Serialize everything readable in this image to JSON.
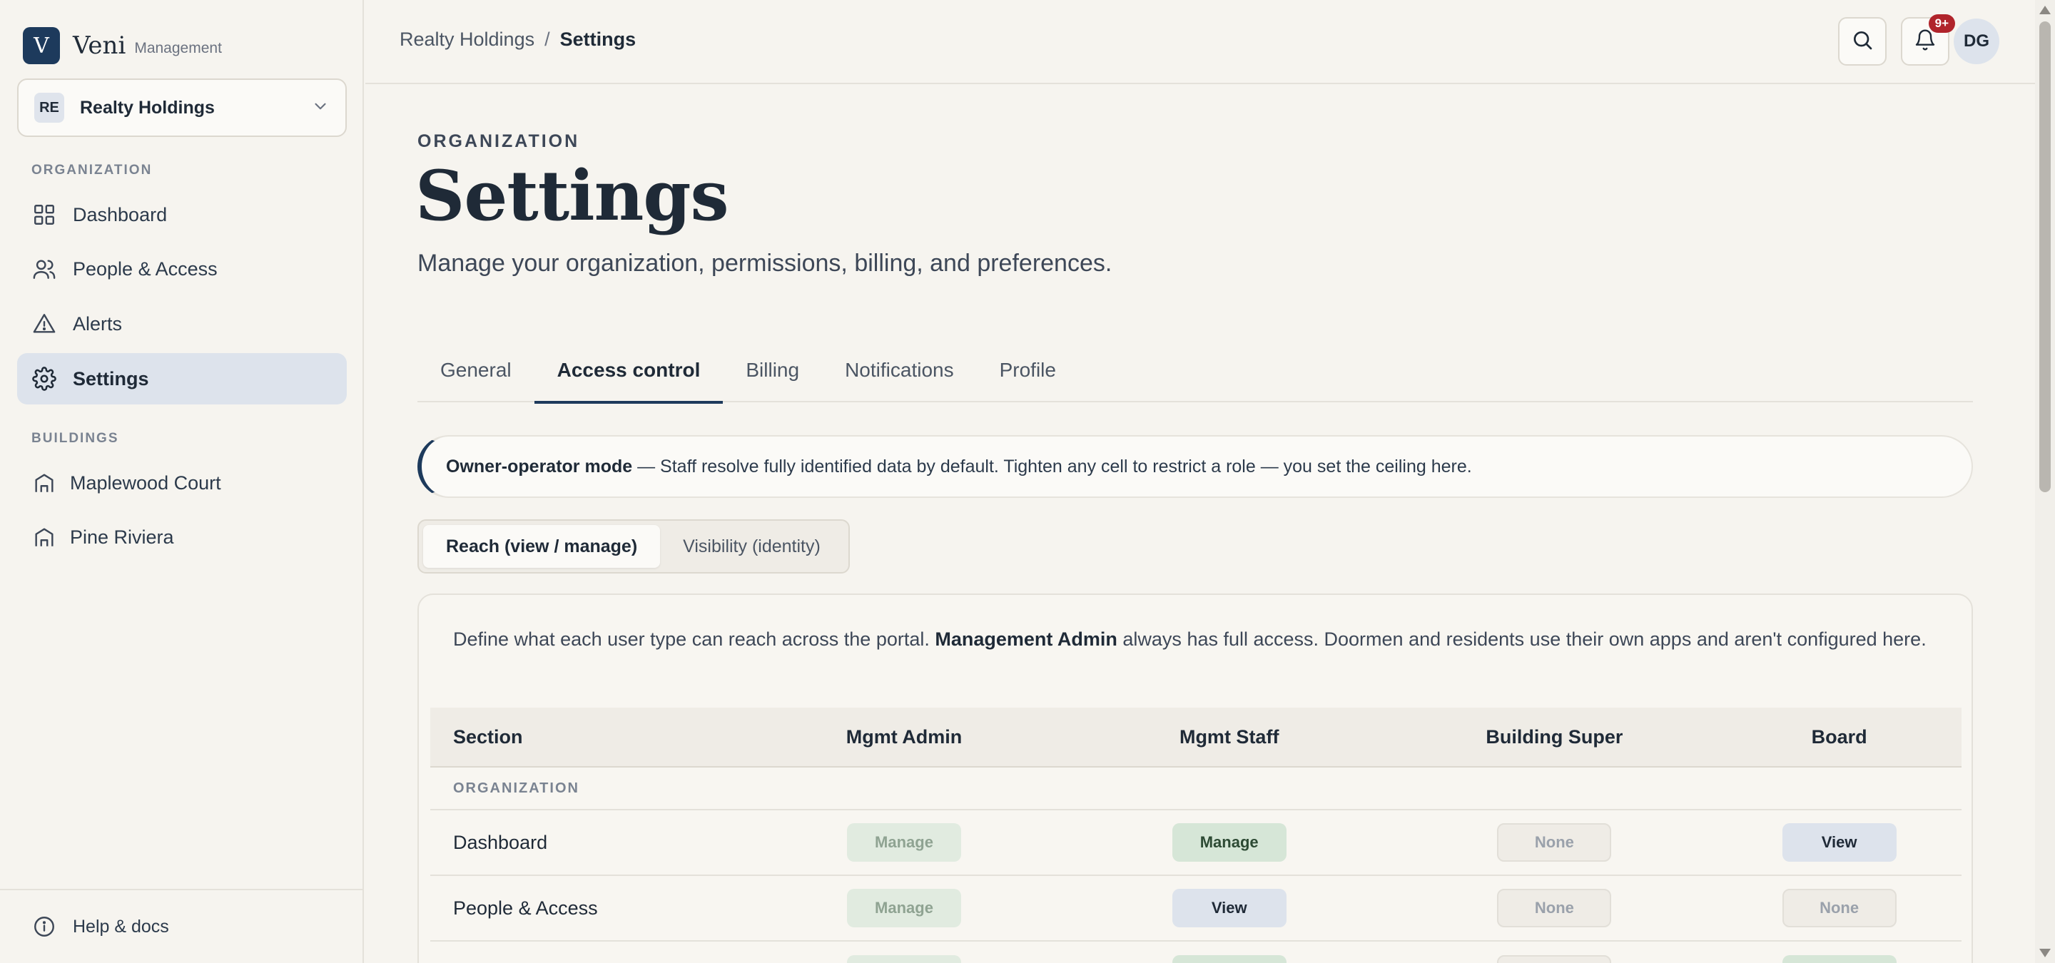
{
  "brand": {
    "logo_letter": "V",
    "name": "Veni",
    "sub": "Management"
  },
  "org_switcher": {
    "badge": "RE",
    "name": "Realty Holdings"
  },
  "sidebar": {
    "organization_label": "ORGANIZATION",
    "org_items": [
      {
        "label": "Dashboard",
        "icon": "dashboard-grid-icon"
      },
      {
        "label": "People & Access",
        "icon": "people-icon"
      },
      {
        "label": "Alerts",
        "icon": "alert-triangle-icon"
      },
      {
        "label": "Settings",
        "icon": "gear-icon",
        "active": true
      }
    ],
    "buildings_label": "BUILDINGS",
    "building_items": [
      {
        "label": "Maplewood Court",
        "icon": "building-icon"
      },
      {
        "label": "Pine Riviera",
        "icon": "building-icon"
      }
    ],
    "footer": {
      "label": "Help & docs",
      "icon": "info-icon"
    }
  },
  "topbar": {
    "breadcrumb": {
      "parent": "Realty Holdings",
      "separator": "/",
      "current": "Settings"
    },
    "notifications_badge": "9+",
    "avatar_initials": "DG"
  },
  "page": {
    "eyebrow": "ORGANIZATION",
    "title": "Settings",
    "subtitle": "Manage your organization, permissions, billing, and preferences."
  },
  "tabs": [
    {
      "label": "General"
    },
    {
      "label": "Access control",
      "active": true
    },
    {
      "label": "Billing"
    },
    {
      "label": "Notifications"
    },
    {
      "label": "Profile"
    }
  ],
  "callout": {
    "strong": "Owner-operator mode",
    "text": " — Staff resolve fully identified data by default. Tighten any cell to restrict a role — you set the ceiling here."
  },
  "segmented": {
    "reach": "Reach (view / manage)",
    "visibility": "Visibility (identity)",
    "active": "reach"
  },
  "card": {
    "desc_before": "Define what each user type can reach across the portal. ",
    "desc_strong": "Management Admin",
    "desc_after": " always has full access. Doormen and residents use their own apps and aren't configured here."
  },
  "table": {
    "headers": [
      "Section",
      "Mgmt Admin",
      "Mgmt Staff",
      "Building Super",
      "Board"
    ],
    "group_label": "ORGANIZATION",
    "rows": [
      {
        "section": "Dashboard",
        "cells": [
          "Manage",
          "Manage",
          "None",
          "View"
        ]
      },
      {
        "section": "People & Access",
        "cells": [
          "Manage",
          "View",
          "None",
          "None"
        ]
      }
    ]
  },
  "colors": {
    "brand_navy": "#1d3a5c",
    "background": "#f6f4ef",
    "active_nav": "#dde3ec",
    "manage_pill": "#d6e6d7",
    "view_pill": "#dde3ec",
    "badge_red": "#b0242b"
  }
}
